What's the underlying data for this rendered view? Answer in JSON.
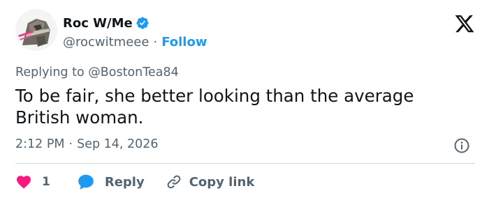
{
  "author": {
    "display_name": "Roc W/Me",
    "handle": "@rocwitmeee",
    "separator": "·",
    "follow_label": "Follow",
    "verified": true,
    "avatar_icon": "cartoon-character-avatar"
  },
  "brand": {
    "logo_icon": "x-logo-icon"
  },
  "reply_context": {
    "prefix": "Replying to",
    "mention": "@BostonTea84"
  },
  "tweet": {
    "text": "To be fair, she better looking than the average British woman."
  },
  "meta": {
    "time": "2:12 PM",
    "separator": "·",
    "date": "Sep 14, 2026",
    "info_icon": "info-icon"
  },
  "actions": {
    "like_count": "1",
    "reply_label": "Reply",
    "copy_label": "Copy link"
  },
  "colors": {
    "accent": "#1d9bf0",
    "like": "#f91880",
    "text": "#0f1419",
    "secondary": "#536471",
    "divider": "#cfd9de"
  }
}
